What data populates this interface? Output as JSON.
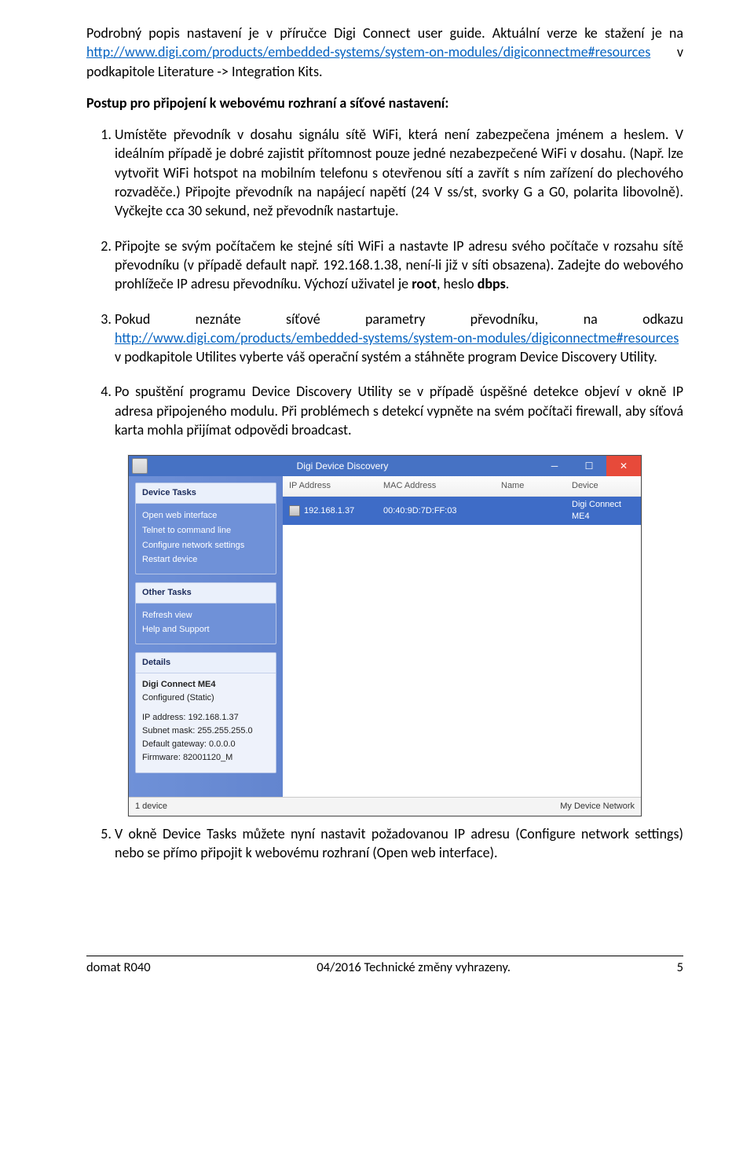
{
  "intro": {
    "pre": "Podrobný popis nastavení je v příručce Digi Connect user guide. Aktuální verze ke stažení je na ",
    "link": "http://www.digi.com/products/embedded-systems/system-on-modules/digiconnectme#resources",
    "post": " v podkapitole Literature -> Integration Kits."
  },
  "heading": "Postup pro připojení k webovému rozhraní a síťové nastavení:",
  "step1": "Umístěte převodník v dosahu signálu sítě WiFi, která není zabezpečena jménem a heslem. V ideálním případě je dobré zajistit přítomnost pouze jedné nezabezpečené WiFi v dosahu. (Např. lze vytvořit WiFi hotspot na mobilním telefonu s otevřenou sítí a zavřít s ním zařízení do plechového rozvaděče.) Připojte převodník na napájecí napětí (24 V ss/st, svorky G a G0, polarita libovolně). Vyčkejte cca 30 sekund, než převodník nastartuje.",
  "step2": {
    "a": "Připojte se svým počítačem ke stejné síti WiFi a nastavte IP adresu svého počítače v rozsahu sítě převodníku (v případě default např. 192.168.1.38, není-li již v síti obsazena). Zadejte do webového prohlížeče IP adresu převodníku. Výchozí uživatel je ",
    "root": "root",
    "b": ", heslo ",
    "dbps": "dbps",
    "c": "."
  },
  "step3": {
    "a": "Pokud neznáte síťové parametry převodníku, na odkazu ",
    "link": "http://www.digi.com/products/embedded-systems/system-on-modules/digiconnectme#resources",
    "b": "  v podkapitole Utilites vyberte váš operační systém a stáhněte program Device Discovery Utility."
  },
  "step4": "Po spuštění programu Device Discovery Utility se v případě úspěšné detekce objeví v okně IP adresa připojeného modulu. Při problémech s detekcí vypněte na svém počítači firewall, aby síťová karta mohla přijímat odpovědi broadcast.",
  "step5": "V okně Device Tasks můžete nyní nastavit požadovanou IP adresu (Configure network settings) nebo se přímo připojit k webovému rozhraní (Open web interface).",
  "app": {
    "title": "Digi Device Discovery",
    "columns": {
      "ip": "IP Address",
      "mac": "MAC Address",
      "name": "Name",
      "device": "Device"
    },
    "row": {
      "ip": "192.168.1.37",
      "mac": "00:40:9D:7D:FF:03",
      "name": "",
      "device": "Digi Connect ME4"
    },
    "panels": {
      "tasks": {
        "title": "Device Tasks",
        "items": [
          "Open web interface",
          "Telnet to command line",
          "Configure network settings",
          "Restart device"
        ]
      },
      "other": {
        "title": "Other Tasks",
        "items": [
          "Refresh view",
          "Help and Support"
        ]
      },
      "details": {
        "title": "Details",
        "name": "Digi Connect ME4",
        "conf": "Configured (Static)",
        "lines": [
          "IP address: 192.168.1.37",
          "Subnet mask: 255.255.255.0",
          "Default gateway: 0.0.0.0",
          "Firmware: 82001120_M"
        ]
      }
    },
    "status": {
      "left": "1 device",
      "right": "My Device Network"
    }
  },
  "footer": {
    "left": "domat R040",
    "center": "04/2016 Technické změny vyhrazeny.",
    "right": "5"
  }
}
